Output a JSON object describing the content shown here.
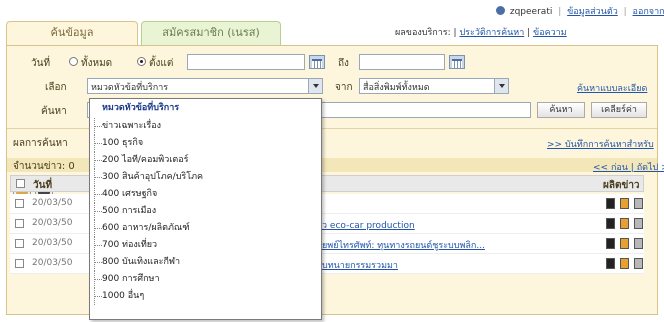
{
  "account": {
    "username": "zqpeerati",
    "links": [
      "ข้อมูลส่วนตัว",
      "ออกจากระบบ"
    ]
  },
  "tabs": [
    {
      "label": "ค้นข้อมูล",
      "active": true
    },
    {
      "label": "สมัครสมาชิก (เนรส)",
      "active": false
    }
  ],
  "services": {
    "prefix": "ผลของบริการ:",
    "value": "",
    "link1": "ประวัติการค้นหา",
    "link2": "ข้อความ"
  },
  "form": {
    "date_label": "วันที่",
    "radio_all": "ทั้งหมด",
    "radio_from": "ตั้งแต่",
    "to_label": "ถึง",
    "date_from": "",
    "date_to": "",
    "category_label": "เลือก",
    "category_value": "หมวดหัวข้อที่บริการ",
    "source_label": "จาก",
    "source_value": "สื่อสิ่งพิมพ์ทั้งหมด",
    "advanced_link": "ค้นหาแบบละเอียด",
    "keyword_label": "ค้นหา",
    "keyword_value": "",
    "search_button": "ค้นหา",
    "clear_button": "เคลียร์ค่า"
  },
  "results_label": "ผลการค้นหา",
  "settings_link": ">> บันทึกการค้นหาสำหรับ",
  "count_band": {
    "label": "จำนวนข่าว: 0",
    "pager": "<< ก่อน | ถัดไป >>"
  },
  "table": {
    "col_date": "วันที่",
    "col_action": "ผลิตข่าว",
    "rows": [
      {
        "date": "20/03/50",
        "title": ""
      },
      {
        "date": "20/03/50",
        "title": "ว eco-car production"
      },
      {
        "date": "20/03/50",
        "title": "ยพย์ไทรศัพท์: ทุนทางรถยนต์ชูระบบพลิก..."
      },
      {
        "date": "20/03/50",
        "title": "บทนายกรรมรวมมา"
      }
    ]
  },
  "dropdown": {
    "items": [
      {
        "label": "หมวดหัวข้อที่บริการ",
        "highlight": true
      },
      {
        "label": "ข่าวเฉพาะเรื่อง"
      },
      {
        "label": "100 ธุรกิจ"
      },
      {
        "label": "200 ไอที/คอมพิวเตอร์"
      },
      {
        "label": "300 สินค้าอุปโภค/บริโภค"
      },
      {
        "label": "400 เศรษฐกิจ"
      },
      {
        "label": "500 การเมือง"
      },
      {
        "label": "600 อาหาร/ผลิตภัณฑ์"
      },
      {
        "label": "700 ท่องเที่ยว"
      },
      {
        "label": "800 บันเทิงและกีฬา"
      },
      {
        "label": "900 การศึกษา"
      },
      {
        "label": "1000 อื่นๆ"
      }
    ]
  },
  "icons": {
    "user": "user-icon",
    "calendar": "calendar-icon",
    "folder": "folder-icon",
    "inbox": "inbox-icon",
    "file_types": [
      "black-file-icon",
      "orange-file-icon",
      "gray-file-icon"
    ]
  },
  "colors": {
    "panel_bg": "#fdf6dc",
    "band": "#f3e6b8",
    "link": "#2255aa",
    "alert": "#c62828"
  }
}
